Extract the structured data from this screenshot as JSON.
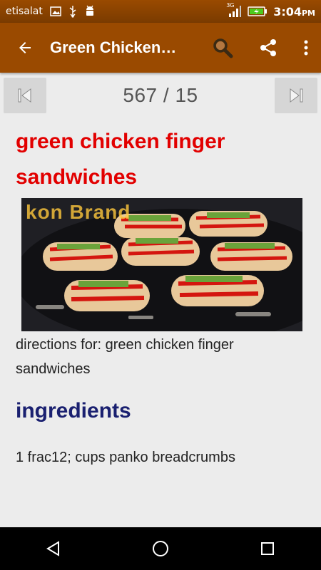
{
  "status_bar": {
    "carrier": "etisalat",
    "network": "3G",
    "time": "3:04",
    "time_suffix": "PM",
    "icons": [
      "image-icon",
      "usb-icon",
      "android-icon",
      "signal-icon",
      "battery-charging-icon"
    ]
  },
  "app_bar": {
    "title": "Green Chicken Finger Sandwiches",
    "icons": [
      "back-arrow-icon",
      "search-icon",
      "share-icon",
      "more-vert-icon"
    ]
  },
  "pager": {
    "counter": "567 / 15",
    "icons": [
      "skip-previous-icon",
      "skip-next-icon"
    ]
  },
  "recipe": {
    "title": "green chicken finger sandwiches",
    "photo_watermark": "kon Brand",
    "directions": "directions for: green chicken finger sandwiches",
    "ingredients_heading": "ingredients",
    "ingredients": [
      "1 frac12; cups panko breadcrumbs"
    ]
  },
  "nav_bar": {
    "icons": [
      "back-triangle-icon",
      "home-circle-icon",
      "recents-square-icon"
    ]
  },
  "colors": {
    "app_bar": "#9a4a00",
    "title_red": "#e20000",
    "heading_navy": "#1a2070",
    "background": "#ececec"
  }
}
